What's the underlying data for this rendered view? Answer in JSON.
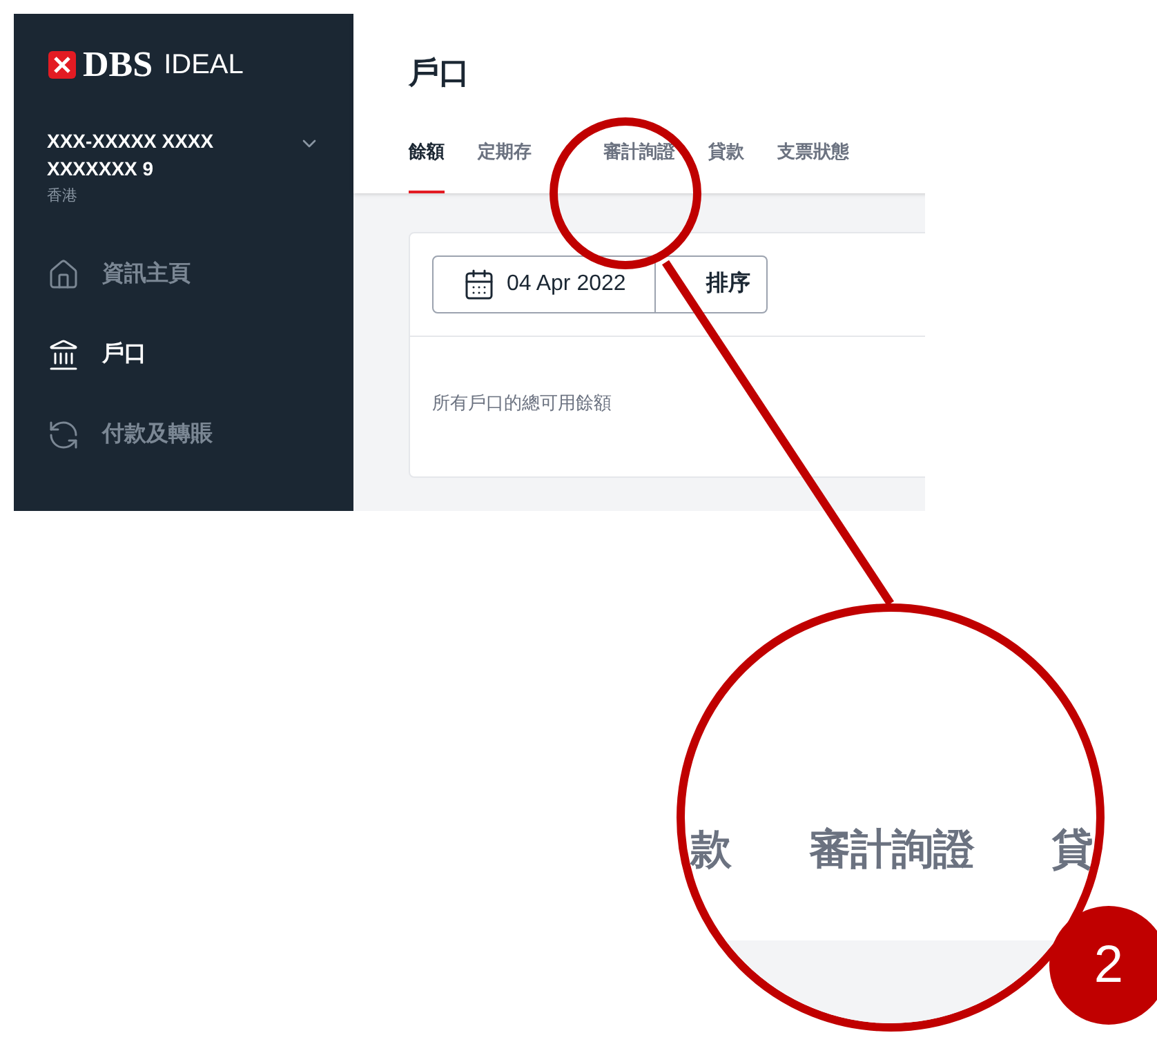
{
  "brand": {
    "logo": "DBS",
    "product": "IDEAL"
  },
  "account": {
    "name": "XXX-XXXXX XXXX XXXXXXX 9",
    "region": "香港",
    "expanded": false
  },
  "nav": [
    {
      "label": "資訊主頁",
      "kind": "home",
      "selected": false
    },
    {
      "label": "戶口",
      "kind": "bank",
      "selected": true
    },
    {
      "label": "付款及轉賬",
      "kind": "transfer",
      "selected": false
    }
  ],
  "page": {
    "title": "戶口"
  },
  "tabs": [
    {
      "label": "餘額",
      "selected": true
    },
    {
      "label": "定期存",
      "selected": false
    },
    {
      "label": "審計詢證",
      "selected": false
    },
    {
      "label": "貸款",
      "selected": false
    },
    {
      "label": "支票狀態",
      "selected": false
    }
  ],
  "date_button": "04 Apr 2022",
  "sort_button": "排序",
  "summary_label": "所有戶口的總可用餘額",
  "callout": {
    "magnified_tabs": [
      "款",
      "審計詢證",
      "貸"
    ],
    "step": "2"
  }
}
